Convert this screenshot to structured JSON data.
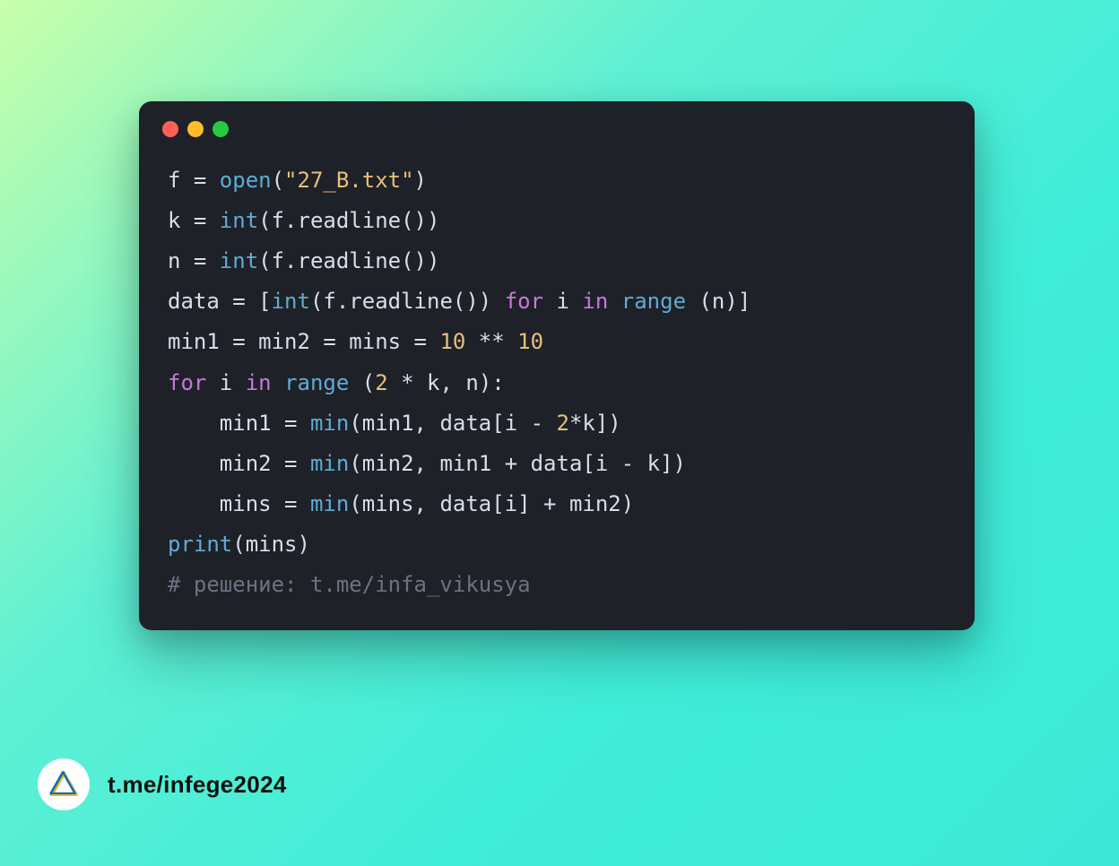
{
  "code": {
    "lines": [
      [
        {
          "t": "f = ",
          "c": ""
        },
        {
          "t": "open",
          "c": "tok-fn"
        },
        {
          "t": "(",
          "c": ""
        },
        {
          "t": "\"27_B.txt\"",
          "c": "tok-str"
        },
        {
          "t": ")",
          "c": ""
        }
      ],
      [
        {
          "t": "k = ",
          "c": ""
        },
        {
          "t": "int",
          "c": "tok-fn"
        },
        {
          "t": "(f.readline())",
          "c": ""
        }
      ],
      [
        {
          "t": "n = ",
          "c": ""
        },
        {
          "t": "int",
          "c": "tok-fn"
        },
        {
          "t": "(f.readline())",
          "c": ""
        }
      ],
      [
        {
          "t": "data = [",
          "c": ""
        },
        {
          "t": "int",
          "c": "tok-fn"
        },
        {
          "t": "(f.readline()) ",
          "c": ""
        },
        {
          "t": "for",
          "c": "tok-kw"
        },
        {
          "t": " i ",
          "c": ""
        },
        {
          "t": "in",
          "c": "tok-kw"
        },
        {
          "t": " ",
          "c": ""
        },
        {
          "t": "range",
          "c": "tok-fn"
        },
        {
          "t": " (n)]",
          "c": ""
        }
      ],
      [
        {
          "t": "min1 = min2 = mins = ",
          "c": ""
        },
        {
          "t": "10",
          "c": "tok-num"
        },
        {
          "t": " ** ",
          "c": ""
        },
        {
          "t": "10",
          "c": "tok-num"
        }
      ],
      [
        {
          "t": "for",
          "c": "tok-kw"
        },
        {
          "t": " i ",
          "c": ""
        },
        {
          "t": "in",
          "c": "tok-kw"
        },
        {
          "t": " ",
          "c": ""
        },
        {
          "t": "range",
          "c": "tok-fn"
        },
        {
          "t": " (",
          "c": ""
        },
        {
          "t": "2",
          "c": "tok-num"
        },
        {
          "t": " * k, n):",
          "c": ""
        }
      ],
      [
        {
          "t": "    min1 = ",
          "c": ""
        },
        {
          "t": "min",
          "c": "tok-fn"
        },
        {
          "t": "(min1, data[i - ",
          "c": ""
        },
        {
          "t": "2",
          "c": "tok-num"
        },
        {
          "t": "*k])",
          "c": ""
        }
      ],
      [
        {
          "t": "    min2 = ",
          "c": ""
        },
        {
          "t": "min",
          "c": "tok-fn"
        },
        {
          "t": "(min2, min1 + data[i - k])",
          "c": ""
        }
      ],
      [
        {
          "t": "    mins = ",
          "c": ""
        },
        {
          "t": "min",
          "c": "tok-fn"
        },
        {
          "t": "(mins, data[i] + min2)",
          "c": ""
        }
      ],
      [
        {
          "t": "print",
          "c": "tok-fn"
        },
        {
          "t": "(mins)",
          "c": ""
        }
      ],
      [
        {
          "t": "# решение: t.me/infa_vikusya",
          "c": "tok-cm"
        }
      ]
    ]
  },
  "colors": {
    "window_bg": "#1f2128",
    "gradient_start": "#c8ffaa",
    "gradient_end": "#3de8d8",
    "dot_red": "#ff5f56",
    "dot_yellow": "#ffbd2e",
    "dot_green": "#27c93f"
  },
  "footer": {
    "link": "t.me/infege2024"
  }
}
